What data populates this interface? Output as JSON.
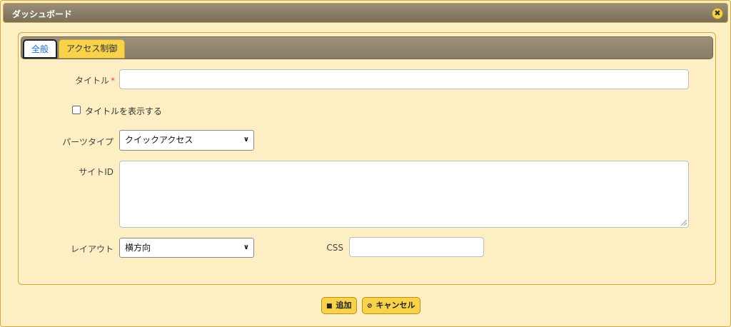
{
  "window": {
    "title": "ダッシュボード",
    "close_icon": "close-icon",
    "close_glyph": "✖"
  },
  "tabs": [
    {
      "label": "全般",
      "active": true
    },
    {
      "label": "アクセス制御",
      "active": false
    }
  ],
  "form": {
    "title_label": "タイトル",
    "title_required_mark": "*",
    "title_value": "",
    "show_title_label": "タイトルを表示する",
    "show_title_checked": false,
    "parts_type_label": "パーツタイプ",
    "parts_type_value": "クイックアクセス",
    "site_id_label": "サイトID",
    "site_id_value": "",
    "layout_label": "レイアウト",
    "layout_value": "横方向",
    "css_label": "CSS",
    "css_value": ""
  },
  "buttons": {
    "add_label": "追加",
    "add_icon": "save-icon",
    "cancel_label": "キャンセル",
    "cancel_icon": "cancel-icon"
  },
  "colors": {
    "accent": "#f7d24a",
    "background": "#fdefc3",
    "titlebar": "#857a64",
    "active_tab_text": "#1a6fc9",
    "required": "#d9534f"
  }
}
